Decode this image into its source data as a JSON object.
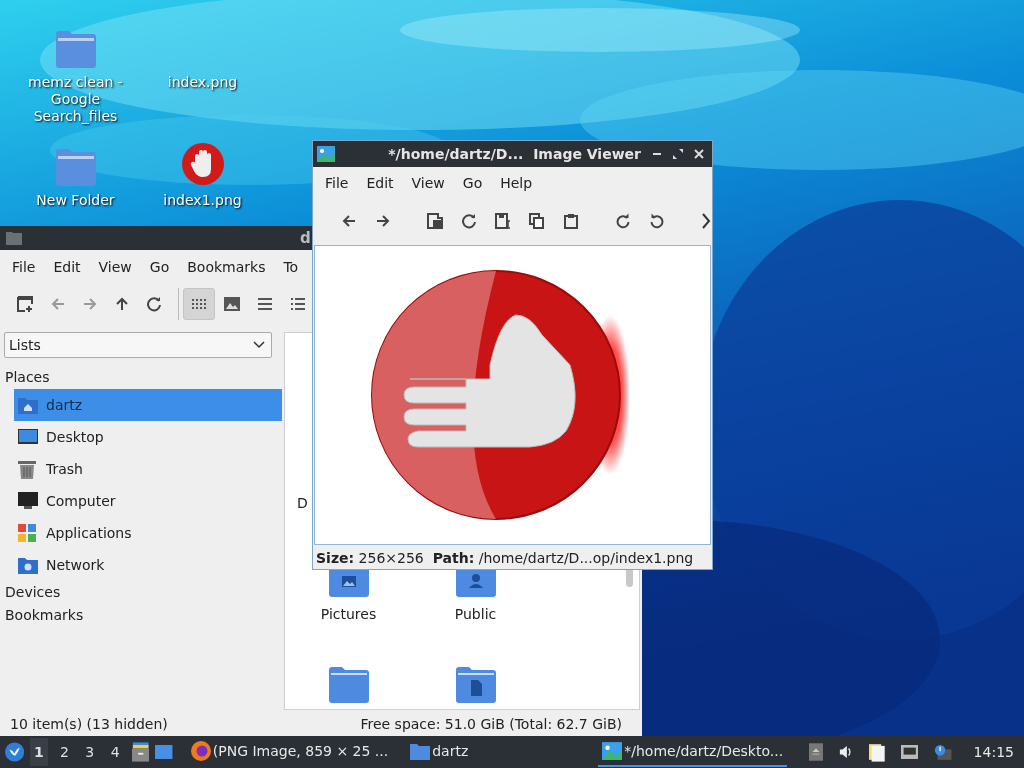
{
  "desktop": {
    "icons": [
      {
        "label": "memz clean - Google Search_files",
        "kind": "folder"
      },
      {
        "label": "index.png",
        "kind": "blank"
      },
      {
        "label": "New Folder",
        "kind": "folder"
      },
      {
        "label": "index1.png",
        "kind": "stop"
      }
    ]
  },
  "file_manager": {
    "title": "d",
    "menu": [
      "File",
      "Edit",
      "View",
      "Go",
      "Bookmarks",
      "To"
    ],
    "view_modes": [
      {
        "kind": "icons",
        "selected": true
      },
      {
        "kind": "thumbnails",
        "selected": false
      },
      {
        "kind": "compact",
        "selected": false
      },
      {
        "kind": "list",
        "selected": false
      }
    ],
    "side_mode": "Lists",
    "places_heading": "Places",
    "places": [
      {
        "label": "dartz",
        "kind": "home",
        "selected": true
      },
      {
        "label": "Desktop",
        "kind": "desktop",
        "selected": false
      },
      {
        "label": "Trash",
        "kind": "trash",
        "selected": false
      },
      {
        "label": "Computer",
        "kind": "computer",
        "selected": false
      },
      {
        "label": "Applications",
        "kind": "apps",
        "selected": false
      },
      {
        "label": "Network",
        "kind": "network",
        "selected": false
      }
    ],
    "other_headings": [
      "Devices",
      "Bookmarks"
    ],
    "partial_label": "D",
    "files": [
      {
        "label": "Pictures",
        "kind": "pictures"
      },
      {
        "label": "Public",
        "kind": "public"
      },
      {
        "kind": "plain"
      },
      {
        "kind": "documents"
      }
    ],
    "status_left": "10 item(s) (13 hidden)",
    "status_right": "Free space: 51.0 GiB (Total: 62.7 GiB)"
  },
  "image_viewer": {
    "title": "*/home/dartz/D...  Image Viewer",
    "menu": [
      "File",
      "Edit",
      "View",
      "Go",
      "Help"
    ],
    "status": "**Size:** 256×256  **Path:** /home/dartz/D...op/index1.png"
  },
  "taskbar": {
    "workspaces": [
      {
        "label": "1",
        "selected": true
      },
      {
        "label": "2",
        "selected": false
      },
      {
        "label": "3",
        "selected": false
      },
      {
        "label": "4",
        "selected": false
      }
    ],
    "tasks": [
      {
        "label": "(PNG Image, 859 × 25 ...",
        "kind": "browser",
        "selected": false
      },
      {
        "label": "dartz",
        "kind": "folder",
        "selected": false
      },
      {
        "label": "*/home/dartz/Deskto...",
        "kind": "viewer",
        "selected": true
      }
    ],
    "clock": "14:15"
  }
}
